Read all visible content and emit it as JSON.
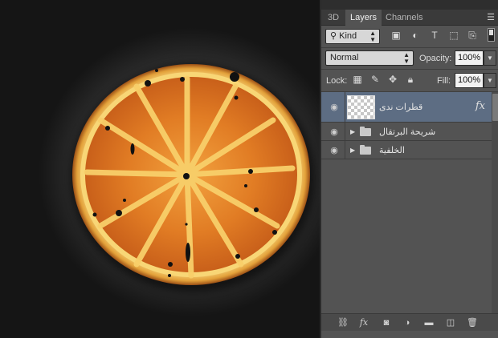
{
  "panel": {
    "tabs": [
      "3D",
      "Layers",
      "Channels"
    ],
    "active_tab": "Layers"
  },
  "filter": {
    "kind_label": "Kind",
    "icons": [
      "image-filter-icon",
      "adjustment-filter-icon",
      "type-filter-icon",
      "shape-filter-icon",
      "smart-object-filter-icon"
    ]
  },
  "blend": {
    "mode": "Normal",
    "opacity_label": "Opacity:",
    "opacity_value": "100%"
  },
  "lock": {
    "label": "Lock:",
    "fill_label": "Fill:",
    "fill_value": "100%"
  },
  "layers": [
    {
      "name": "قطرات ندى",
      "type": "layer",
      "selected": true,
      "has_fx": true,
      "fx_label": "fx"
    },
    {
      "name": "شريحة البرتقال",
      "type": "group",
      "selected": false
    },
    {
      "name": "الخلفية",
      "type": "group",
      "selected": false
    }
  ],
  "footer": {
    "icons": [
      "link-layers-icon",
      "layer-style-fx-icon",
      "add-mask-icon",
      "adjustment-layer-icon",
      "new-group-icon",
      "new-layer-icon",
      "delete-layer-icon"
    ],
    "fx_label": "fx"
  },
  "colors": {
    "panel_bg": "#535353",
    "selected_layer": "#5d6d83",
    "orange": "#e8842a",
    "rind": "#f5c24e"
  }
}
